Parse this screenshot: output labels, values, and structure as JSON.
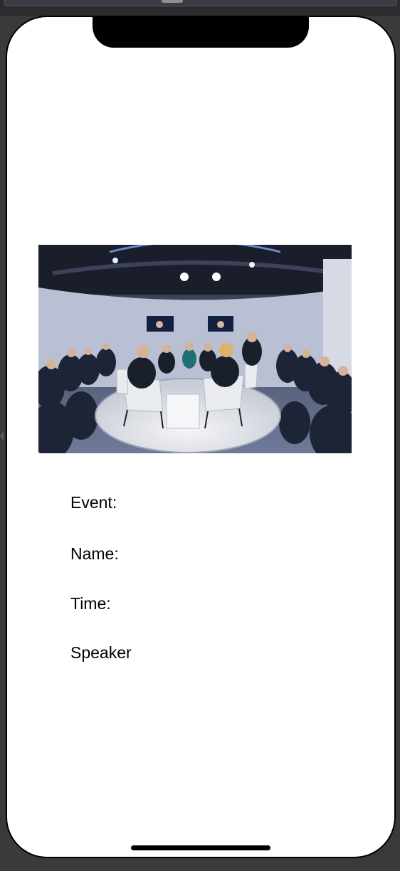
{
  "event_details": {
    "event_label": "Event:",
    "name_label": "Name:",
    "time_label": "Time:",
    "speaker_label": "Speaker"
  },
  "hero_image": {
    "description_icon": "panel-discussion-photo"
  }
}
